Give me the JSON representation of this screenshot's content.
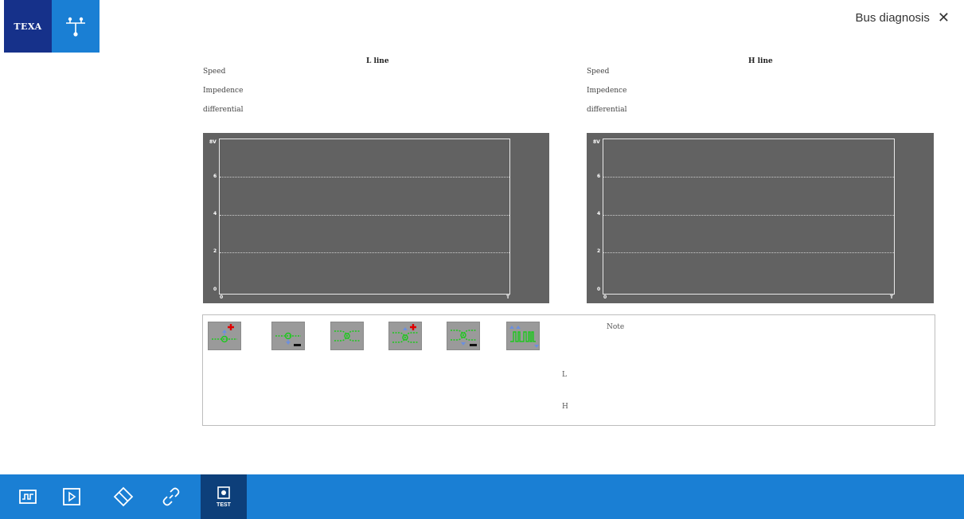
{
  "header": {
    "logo_text": "TEXA",
    "title": "Bus diagnosis",
    "close_glyph": "✕"
  },
  "panels": [
    {
      "title": "L line",
      "labels": [
        "Speed",
        "Impedence",
        "differential"
      ]
    },
    {
      "title": "H line",
      "labels": [
        "Speed",
        "Impedence",
        "differential"
      ]
    }
  ],
  "graph": {
    "y_ticks": [
      "8V",
      "6",
      "4",
      "2",
      "0"
    ],
    "x_ticks": [
      "0",
      "T"
    ]
  },
  "tests": {
    "icons": [
      "short-to-positive-icon",
      "short-to-ground-icon",
      "line-connection-icon",
      "line-connection-positive-icon",
      "line-connection-ground-icon",
      "signal-waveform-icon"
    ],
    "note_label": "Note",
    "l_label": "L",
    "h_label": "H"
  },
  "toolbar": {
    "icons": [
      "oscilloscope-icon",
      "play-icon",
      "eraser-icon",
      "link-icon"
    ],
    "test_label": "TEST"
  },
  "colors": {
    "brand_dark": "#16318a",
    "brand_blue": "#1a7fd4",
    "graph_bg": "#626262",
    "active_tab": "#0d3f7a"
  }
}
